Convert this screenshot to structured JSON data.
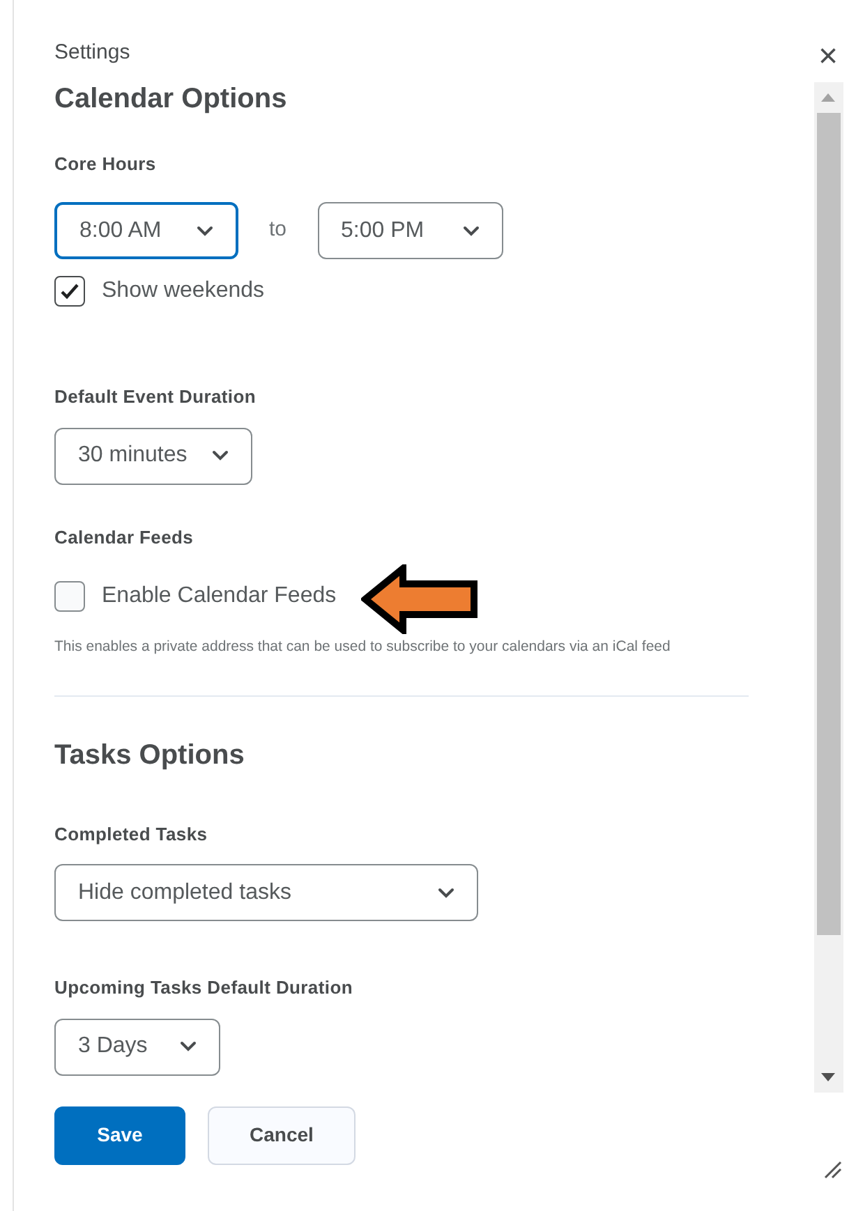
{
  "dialog": {
    "subtitle": "Settings",
    "close": "×"
  },
  "calendar_options": {
    "title": "Calendar Options",
    "core_hours": {
      "label": "Core Hours",
      "start": {
        "value": "8:00 AM",
        "focused": true
      },
      "separator": "to",
      "end": {
        "value": "5:00 PM",
        "focused": false
      }
    },
    "show_weekends": {
      "label": "Show weekends",
      "checked": true
    },
    "default_event_duration": {
      "label": "Default Event Duration",
      "value": "30 minutes"
    },
    "calendar_feeds": {
      "label": "Calendar Feeds",
      "checkbox": {
        "label": "Enable Calendar Feeds",
        "checked": false
      },
      "help": "This enables a private address that can be used to subscribe to your calendars via an iCal feed"
    }
  },
  "tasks_options": {
    "title": "Tasks Options",
    "completed_tasks": {
      "label": "Completed Tasks",
      "value": "Hide completed tasks"
    },
    "upcoming_duration": {
      "label": "Upcoming Tasks Default Duration",
      "value": "3 Days"
    }
  },
  "buttons": [
    {
      "label": "Save",
      "kind": "primary"
    },
    {
      "label": "Cancel",
      "kind": "secondary"
    }
  ]
}
